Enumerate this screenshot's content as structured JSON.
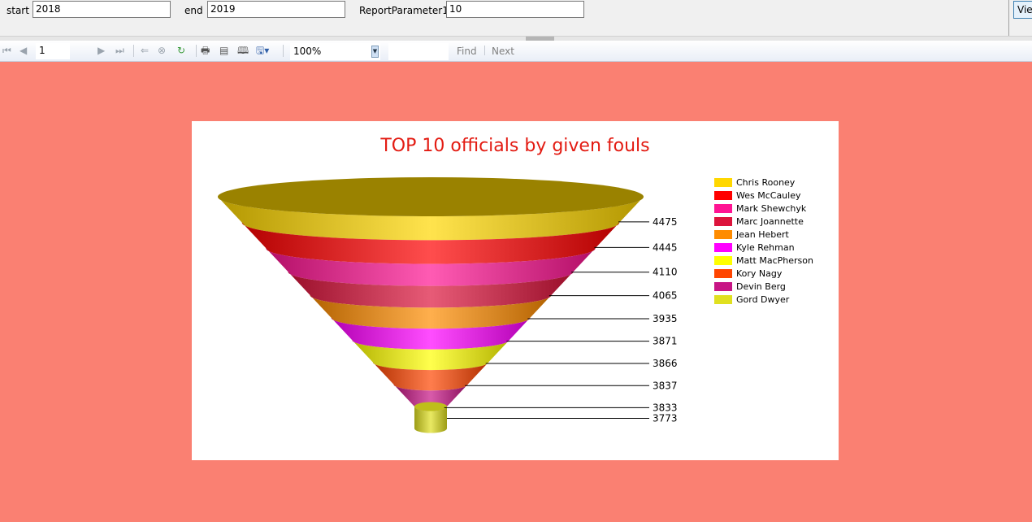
{
  "parameters": {
    "start_label": "start",
    "start_value": "2018",
    "end_label": "end",
    "end_value": "2019",
    "param1_label": "ReportParameter1",
    "param1_value": "10",
    "view_button": "View Report"
  },
  "toolbar": {
    "page_value": "1",
    "zoom_value": "100%",
    "find_value": "",
    "find_label": "Find",
    "next_label": "Next",
    "icons": [
      "first-page-icon",
      "previous-page-icon",
      "next-page-icon",
      "last-page-icon",
      "back-icon",
      "stop-icon",
      "refresh-icon",
      "print-icon",
      "print-layout-icon",
      "page-setup-icon",
      "export-icon"
    ]
  },
  "chart_data": {
    "type": "funnel",
    "title": "TOP 10 officials by given fouls",
    "categories": [
      "Chris Rooney",
      "Wes McCauley",
      "Mark Shewchyk",
      "Marc Joannette",
      "Jean Hebert",
      "Kyle Rehman",
      "Matt MacPherson",
      "Kory Nagy",
      "Devin Berg",
      "Gord Dwyer"
    ],
    "values": [
      4475,
      4445,
      4110,
      4065,
      3935,
      3871,
      3866,
      3837,
      3833,
      3773
    ],
    "colors": [
      "#ffd700",
      "#ff0000",
      "#ff1493",
      "#dc143c",
      "#ff8c00",
      "#ff00ff",
      "#ffff00",
      "#ff4500",
      "#c71585",
      "#e0e020"
    ],
    "legend_position": "right"
  }
}
